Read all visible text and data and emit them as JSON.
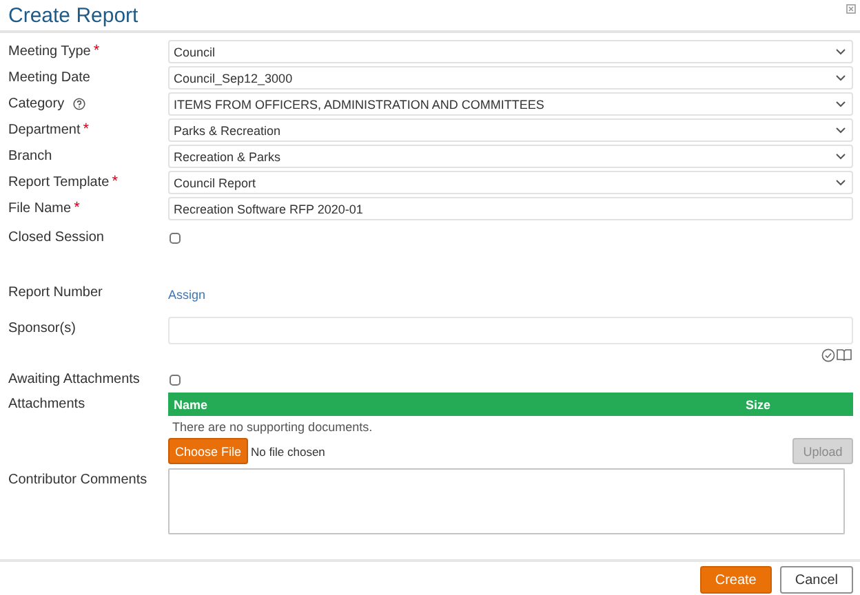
{
  "dialog": {
    "title": "Create Report"
  },
  "fields": [
    {
      "kind": "select",
      "label": "Meeting Type",
      "marker": "*",
      "help": false,
      "value": "Council"
    },
    {
      "kind": "select",
      "label": "Meeting Date",
      "help": false,
      "value": "Council_Sep12_3000"
    },
    {
      "kind": "select",
      "label": "Category",
      "help": true,
      "value": "ITEMS FROM OFFICERS, ADMINISTRATION AND COMMITTEES"
    },
    {
      "kind": "select",
      "label": "Department",
      "marker": "*",
      "help": false,
      "value": "Parks & Recreation"
    },
    {
      "kind": "select",
      "label": "Branch",
      "help": false,
      "value": "Recreation & Parks"
    },
    {
      "kind": "select",
      "label": "Report Template",
      "marker": "*",
      "help": false,
      "value": "Council Report"
    },
    {
      "kind": "text",
      "label": "File Name",
      "marker": "*",
      "help": false,
      "value": "Recreation Software RFP 2020-01"
    },
    {
      "kind": "checkbox",
      "label": "Closed Session",
      "help": false,
      "checked": false
    },
    {
      "kind": "link",
      "label": "Report Number",
      "help": false,
      "link": "Assign"
    },
    {
      "kind": "picker",
      "label": "Sponsor(s)",
      "help": false
    },
    {
      "kind": "checkbox",
      "label": "Awaiting Attachments",
      "help": false,
      "checked": false
    },
    {
      "kind": "attachments",
      "label": "Attachments",
      "help": false,
      "columns": [
        "Name",
        "Size"
      ],
      "empty": "There are no supporting documents.",
      "choose": "Choose File",
      "chosen": "No file chosen",
      "upload": {
        "label": "Upload",
        "disabled": true
      }
    },
    {
      "kind": "textarea",
      "label": "Contributor Comments",
      "help": false
    }
  ],
  "buttons": [
    {
      "label": "Create",
      "primary": true
    },
    {
      "label": "Cancel",
      "primary": false
    }
  ]
}
